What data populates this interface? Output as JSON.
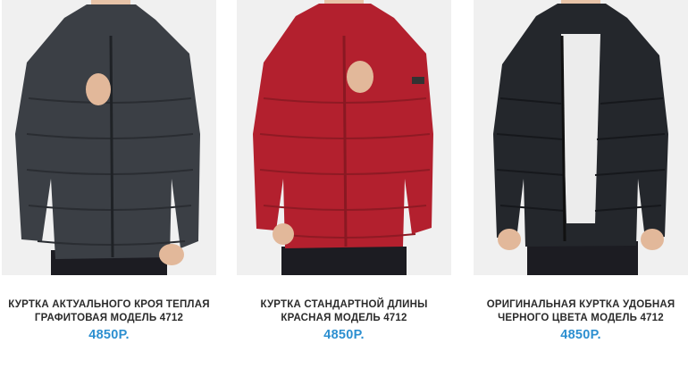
{
  "products": [
    {
      "title": "КУРТКА АКТУАЛЬНОГО КРОЯ ТЕПЛАЯ ГРАФИТОВАЯ МОДЕЛЬ 4712",
      "price": "4850Р.",
      "jacket_color": "#3b3f45",
      "shirt_color": "#8a9098"
    },
    {
      "title": "КУРТКА СТАНДАРТНОЙ ДЛИНЫ КРАСНАЯ МОДЕЛЬ 4712",
      "price": "4850Р.",
      "jacket_color": "#b3202e",
      "shirt_color": "#f4f4f4"
    },
    {
      "title": "ОРИГИНАЛЬНАЯ КУРТКА УДОБНАЯ ЧЕРНОГО ЦВЕТА МОДЕЛЬ 4712",
      "price": "4850Р.",
      "jacket_color": "#24272c",
      "shirt_color": "#ececec"
    }
  ],
  "colors": {
    "price": "#2c8fd0",
    "title": "#2b2b2b",
    "photo_bg": "#f0f0f0"
  }
}
